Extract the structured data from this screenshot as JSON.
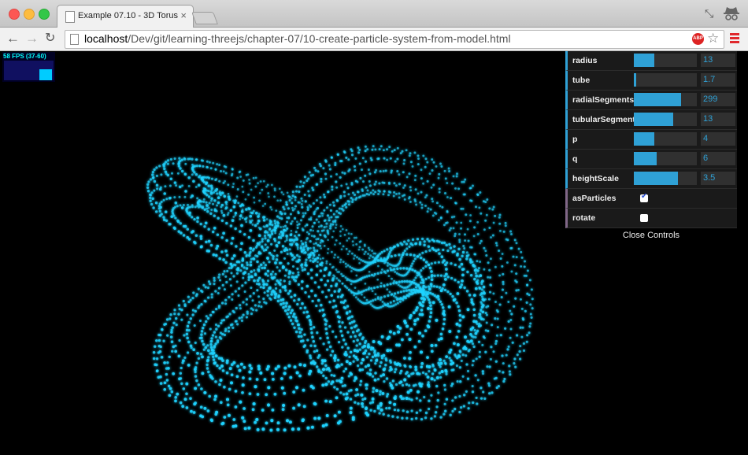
{
  "browser": {
    "tab_title": "Example 07.10 - 3D Torus",
    "tab_close": "×",
    "url_host": "localhost",
    "url_path": "/Dev/git/learning-threejs/chapter-07/10-create-particle-system-from-model.html",
    "adblock_label": "ABP"
  },
  "stats": {
    "fps_text": "58 FPS (37-60)"
  },
  "controls": {
    "items": [
      {
        "label": "radius",
        "value": "13",
        "fraction": 0.325
      },
      {
        "label": "tube",
        "value": "1.7",
        "fraction": 0.04
      },
      {
        "label": "radialSegments",
        "value": "299",
        "fraction": 0.75
      },
      {
        "label": "tubularSegments",
        "value": "13",
        "fraction": 0.63
      },
      {
        "label": "p",
        "value": "4",
        "fraction": 0.33
      },
      {
        "label": "q",
        "value": "6",
        "fraction": 0.36
      },
      {
        "label": "heightScale",
        "value": "3.5",
        "fraction": 0.7
      }
    ],
    "toggles": [
      {
        "label": "asParticles",
        "checked": true
      },
      {
        "label": "rotate",
        "checked": false
      }
    ],
    "close_label": "Close Controls"
  },
  "colors": {
    "accent": "#2fa1d6",
    "particle": "#1fd3ff",
    "boolean_marker": "#806787"
  }
}
